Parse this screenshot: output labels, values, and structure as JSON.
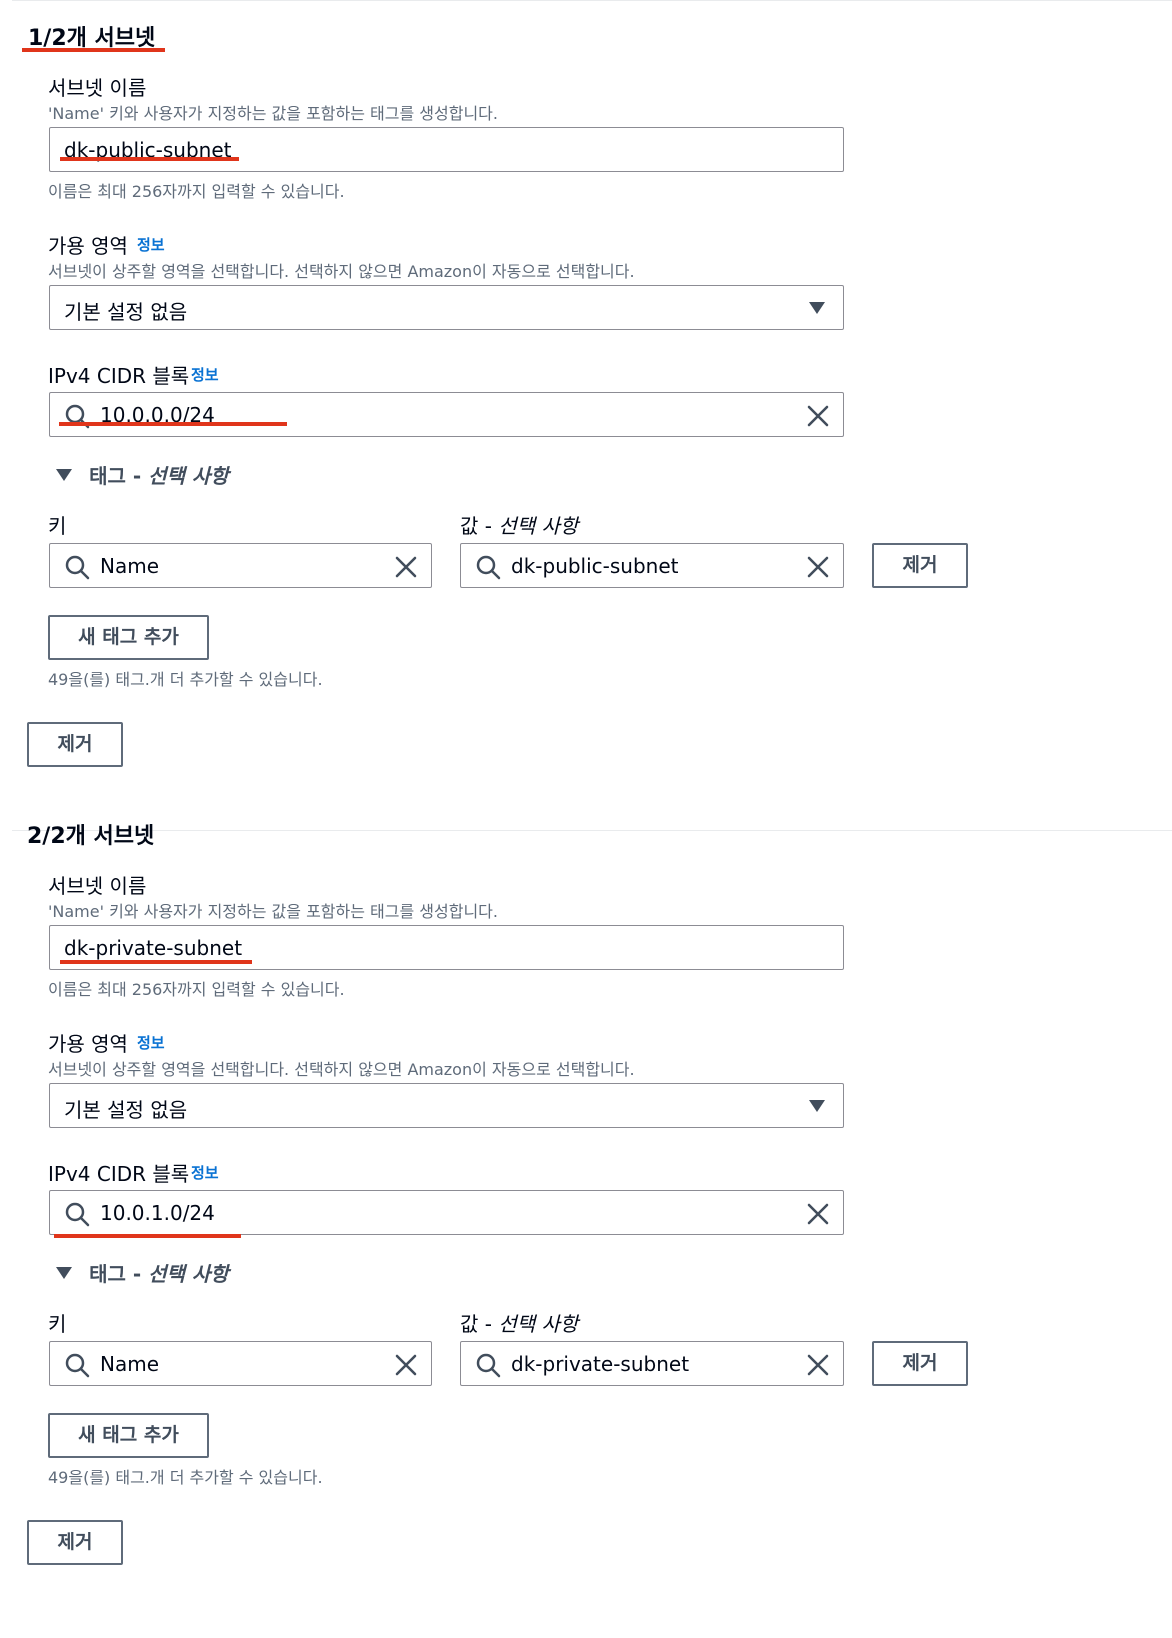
{
  "subnets": [
    {
      "title": "1/2개 서브넷",
      "name_label": "서브넷 이름",
      "name_desc": "'Name' 키와 사용자가 지정하는 값을 포함하는 태그를 생성합니다.",
      "name_value": "dk-public-subnet",
      "name_hint": "이름은 최대 256자까지 입력할 수 있습니다.",
      "az_label": "가용 영역",
      "az_info": "정보",
      "az_desc": "서브넷이 상주할 영역을 선택합니다. 선택하지 않으면 Amazon이 자동으로 선택합니다.",
      "az_value": "기본 설정 없음",
      "cidr_label": "IPv4 CIDR 블록",
      "cidr_info": "정보",
      "cidr_value": "10.0.0.0/24",
      "tags_toggle_prefix": "태그 - ",
      "tags_toggle_optional": "선택 사항",
      "key_label": "키",
      "value_label_prefix": "값 - ",
      "value_label_optional": "선택 사항",
      "tag_key": "Name",
      "tag_value": "dk-public-subnet",
      "remove_tag_label": "제거",
      "add_tag_label": "새 태그 추가",
      "tags_remaining": "49을(를) 태그.개 더 추가할 수 있습니다.",
      "remove_subnet_label": "제거"
    },
    {
      "title": "2/2개 서브넷",
      "name_label": "서브넷 이름",
      "name_desc": "'Name' 키와 사용자가 지정하는 값을 포함하는 태그를 생성합니다.",
      "name_value": "dk-private-subnet",
      "name_hint": "이름은 최대 256자까지 입력할 수 있습니다.",
      "az_label": "가용 영역",
      "az_info": "정보",
      "az_desc": "서브넷이 상주할 영역을 선택합니다. 선택하지 않으면 Amazon이 자동으로 선택합니다.",
      "az_value": "기본 설정 없음",
      "cidr_label": "IPv4 CIDR 블록",
      "cidr_info": "정보",
      "cidr_value": "10.0.1.0/24",
      "tags_toggle_prefix": "태그 - ",
      "tags_toggle_optional": "선택 사항",
      "key_label": "키",
      "value_label_prefix": "값 - ",
      "value_label_optional": "선택 사항",
      "tag_key": "Name",
      "tag_value": "dk-private-subnet",
      "remove_tag_label": "제거",
      "add_tag_label": "새 태그 추가",
      "tags_remaining": "49을(를) 태그.개 더 추가할 수 있습니다.",
      "remove_subnet_label": "제거"
    }
  ],
  "colors": {
    "annotation_red": "#e0351b",
    "link_blue": "#0972d3",
    "border_gray": "#8c8c94"
  }
}
